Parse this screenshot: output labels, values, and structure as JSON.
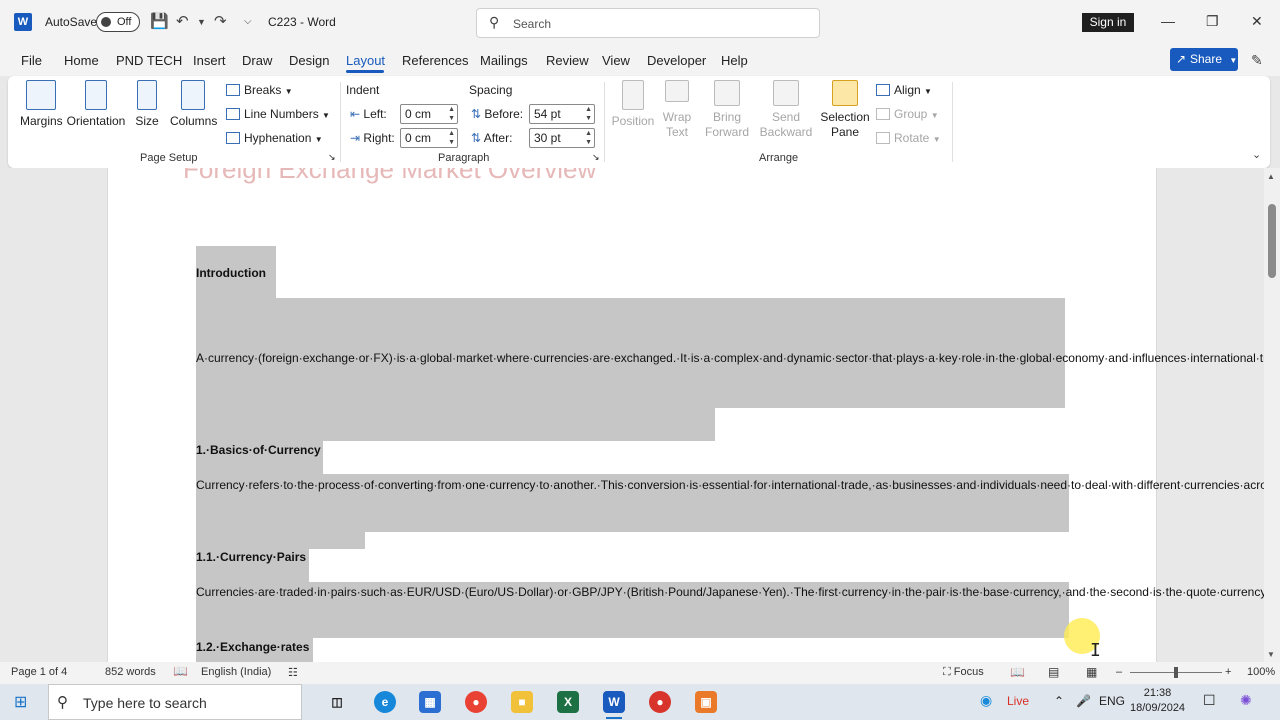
{
  "titlebar": {
    "autosave_label": "AutoSave",
    "autosave_state": "Off",
    "doc_title": "C223 - Word",
    "search_placeholder": "Search",
    "signin_label": "Sign in",
    "icons": [
      "save-icon",
      "undo-icon",
      "redo-icon",
      "customize-icon",
      "minimize-icon",
      "restore-icon",
      "close-icon"
    ]
  },
  "menu": {
    "tabs": [
      "File",
      "Home",
      "PND TECH",
      "Insert",
      "Draw",
      "Design",
      "Layout",
      "References",
      "Mailings",
      "Review",
      "View",
      "Developer",
      "Help"
    ],
    "active_tab": "Layout",
    "share_label": "Share"
  },
  "ribbon": {
    "page_setup": {
      "label": "Page Setup",
      "margins": "Margins",
      "orientation": "Orientation",
      "size": "Size",
      "columns": "Columns",
      "breaks": "Breaks",
      "line_numbers": "Line Numbers",
      "hyphenation": "Hyphenation"
    },
    "paragraph": {
      "label": "Paragraph",
      "indent_header": "Indent",
      "spacing_header": "Spacing",
      "left_label": "Left:",
      "left_value": "0 cm",
      "right_label": "Right:",
      "right_value": "0 cm",
      "before_label": "Before:",
      "before_value": "54 pt",
      "after_label": "After:",
      "after_value": "30 pt"
    },
    "arrange": {
      "label": "Arrange",
      "position": "Position",
      "wrap_text_1": "Wrap",
      "wrap_text_2": "Text",
      "bring_forward_1": "Bring",
      "bring_forward_2": "Forward",
      "send_backward_1": "Send",
      "send_backward_2": "Backward",
      "selection_pane_1": "Selection",
      "selection_pane_2": "Pane",
      "align": "Align",
      "group": "Group",
      "rotate": "Rotate"
    }
  },
  "document": {
    "title_partial": "Foreign Exchange Market Overview",
    "paragraphs": [
      {
        "type": "heading",
        "text": "Introduction"
      },
      {
        "type": "body",
        "text": "A·currency·(foreign·exchange·or·FX)·is·a·global·market·where·currencies·are·exchanged.·It·is·a·complex·and·dynamic·sector·that·plays·a·key·role·in·the·global·economy·and·influences·international·trade,·investment·and·financial·markets.·This·article·provides·a·comprehensive·overview·of·Forex,·including·its·basic·concepts,·mechanics,·and·implications·for·participants,·companies,·and·individual·investors."
      },
      {
        "type": "heading",
        "text": "1.·Basics·of·Currency"
      },
      {
        "type": "body",
        "text": "Currency·refers·to·the·process·of·converting·from·one·currency·to·another.·This·conversion·is·essential·for·international·trade,·as·businesses·and·individuals·need·to·deal·with·different·currencies·across·borders.·The·forex·market·is·the·largest·financial·market·in·the·world,·with·an·average·daily·transaction·volume·exceeding·$6·trillion·in·2023."
      },
      {
        "type": "heading",
        "text": "1.1.·Currency·Pairs"
      },
      {
        "type": "body",
        "text": "Currencies·are·traded·in·pairs·such·as·EUR/USD·(Euro/US·Dollar)·or·GBP/JPY·(British·Pound/Japanese·Yen).·The·first·currency·in·the·pair·is·the·base·currency,·and·the·second·is·the·quote·currency.·The·price·of·a·currency·pair·reflects·the·amount·of·quote·currency·needed·to·buy·a·unit·of·base·currency."
      },
      {
        "type": "heading",
        "text": "1.2.·Exchange·rates"
      }
    ]
  },
  "statusbar": {
    "page": "Page 1 of 4",
    "words": "852 words",
    "language": "English (India)",
    "focus": "Focus",
    "zoom": "100%"
  },
  "taskbar": {
    "search_placeholder": "Type here to search",
    "live": "Live",
    "lang": "ENG",
    "time": "21:38",
    "date": "18/09/2024"
  },
  "colors": {
    "accent": "#185abd",
    "selection": "#c6c6c6",
    "excel": "#1d7044",
    "word": "#185abd"
  }
}
